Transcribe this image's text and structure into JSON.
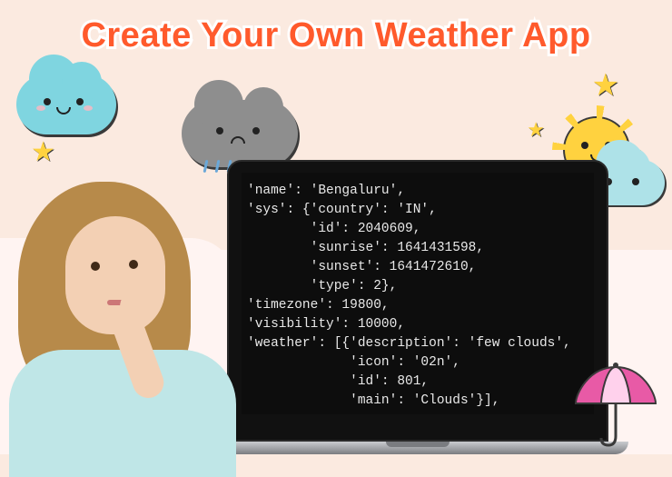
{
  "title": "Create Your Own Weather App",
  "code_output": "'name': 'Bengaluru',\n'sys': {'country': 'IN',\n        'id': 2040609,\n        'sunrise': 1641431598,\n        'sunset': 1641472610,\n        'type': 2},\n'timezone': 19800,\n'visibility': 10000,\n'weather': [{'description': 'few clouds',\n             'icon': '02n',\n             'id': 801,\n             'main': 'Clouds'}],",
  "decorations": {
    "cloud_happy": "happy-cloud-icon",
    "cloud_sad_rain": "sad-rain-cloud-icon",
    "sun_with_cloud": "sun-cloud-icon",
    "lightning": "lightning-icon",
    "umbrella": "umbrella-icon",
    "stars": "star-icon"
  },
  "person_alt": "Thinking girl in light blue shirt"
}
